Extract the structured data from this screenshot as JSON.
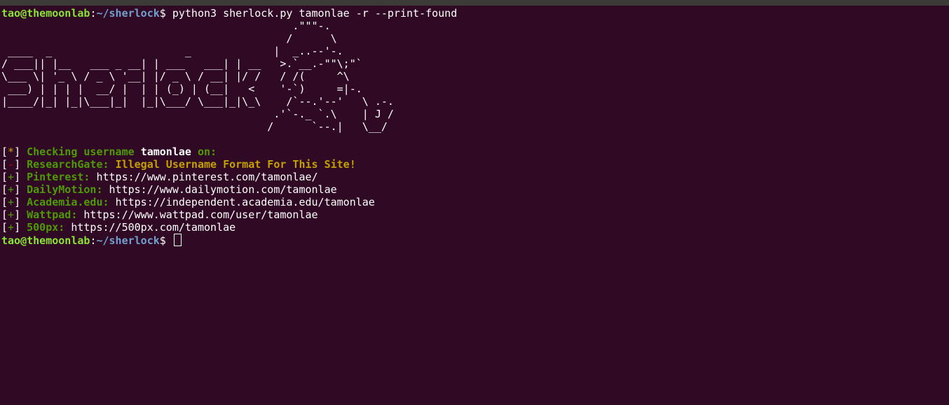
{
  "prompt": {
    "user_host": "tao@themoonlab",
    "colon": ":",
    "path": "~/sherlock",
    "dollar": "$"
  },
  "command": "python3 sherlock.py tamonlae -r --print-found",
  "banner_ascii": "                                              .\"\"\"-.\n                                             /      \\\n ____  _                     _             |  _..--'-.\n/ ___|| |__   ___ _ __| | ___   ___| | __   >.`__.-\"\"\\;\"`\n\\___ \\| '_ \\ / _ \\ '__| |/ _ \\ / __| |/ /   / /(     ^\\\n ___) | | | |  __/ |  | | (_) | (__|   <    '-`)     =|-.\n|____/|_| |_|\\___|_|  |_|\\___/ \\___|_|\\_\\    /`--.'--'   \\ .-.\n                                           .'`-._ `.\\    | J /\n                                          /      `--.|   \\__/",
  "results": [
    {
      "symbol": "*",
      "kind": "info",
      "label": "Checking username",
      "username": "tamonlae",
      "suffix": "on:"
    },
    {
      "symbol": "-",
      "kind": "error",
      "site": "ResearchGate:",
      "message": "Illegal Username Format For This Site!"
    },
    {
      "symbol": "+",
      "kind": "found",
      "site": "Pinterest:",
      "url": "https://www.pinterest.com/tamonlae/"
    },
    {
      "symbol": "+",
      "kind": "found",
      "site": "DailyMotion:",
      "url": "https://www.dailymotion.com/tamonlae"
    },
    {
      "symbol": "+",
      "kind": "found",
      "site": "Academia.edu:",
      "url": "https://independent.academia.edu/tamonlae"
    },
    {
      "symbol": "+",
      "kind": "found",
      "site": "Wattpad:",
      "url": "https://www.wattpad.com/user/tamonlae"
    },
    {
      "symbol": "+",
      "kind": "found",
      "site": "500px:",
      "url": "https://500px.com/tamonlae"
    }
  ],
  "colors": {
    "background": "#300a24",
    "prompt_user": "#8ae234",
    "prompt_path": "#729fcf",
    "found": "#4e9a06",
    "warning": "#c4a000",
    "error": "#cc0000"
  }
}
